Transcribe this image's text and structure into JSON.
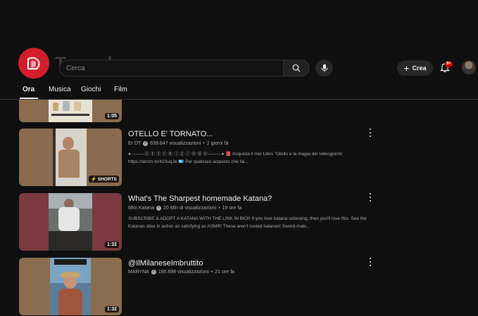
{
  "header": {
    "search_placeholder": "Cerca",
    "create_label": "Crea",
    "notification_count": "9+",
    "brand_color": "#d11f2b"
  },
  "tabs": [
    {
      "label": "Ora",
      "active": true
    },
    {
      "label": "Musica",
      "active": false
    },
    {
      "label": "Giochi",
      "active": false
    },
    {
      "label": "Film",
      "active": false
    }
  ],
  "videos": [
    {
      "title": "",
      "duration": "1:05",
      "thumb_color": "#8a6d4e"
    },
    {
      "title": "OTELLO E' TORNATO...",
      "channel": "Er DT",
      "views": "639.647 visualizzazioni",
      "age": "2 giorni fa",
      "description": "●———Ⓢ Ⓔ Ⓢ Ⓒ Ⓡ Ⓘ Ⓩ Ⓘ Ⓞ Ⓝ Ⓔ———● 📕 Acquista il mio Libro \"Otello e la magia dei videogiochi: https://amzn.to/420uqJe 💶 Per qualsiasi acquisto che fai...",
      "badge": "SHORTS",
      "thumb_color": "#8a6b4f"
    },
    {
      "title": "What's The Sharpest homemade Katana?",
      "channel": "Mini Katana",
      "views": "20 Mln di visualizzazioni",
      "age": "19 ore fa",
      "description": "SUBSCRIBE & ADOPT A KATANA WITH THE LINK IN BIO!! If you love katana unboxing, then you'll love this. See the Katanas slice in action as satisfying as ASMR! These aren't rusted katanas! Sword-maki...",
      "duration": "1:32",
      "thumb_color": "#7a3a40"
    },
    {
      "title": "@IlMilaneseImbruttito",
      "channel": "MARYNA",
      "views": "195.898 visualizzazioni",
      "age": "21 ore fa",
      "duration": "1:32",
      "thumb_color": "#8a6d4e"
    }
  ]
}
